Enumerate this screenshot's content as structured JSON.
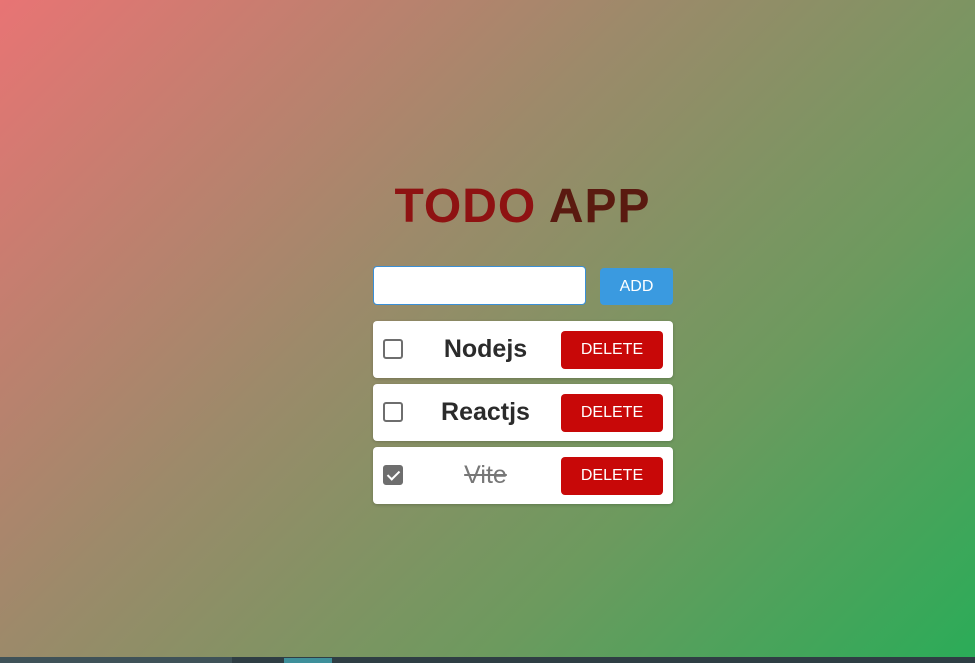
{
  "app": {
    "title_part1": "TODO",
    "title_part2": "APP"
  },
  "add_form": {
    "input_value": "",
    "input_placeholder": "",
    "add_label": "ADD"
  },
  "todos": [
    {
      "text": "Nodejs",
      "completed": false,
      "delete_label": "DELETE"
    },
    {
      "text": "Reactjs",
      "completed": false,
      "delete_label": "DELETE"
    },
    {
      "text": "Vite",
      "completed": true,
      "delete_label": "DELETE"
    }
  ],
  "colors": {
    "title_primary": "#8e1212",
    "title_secondary": "#5a1a10",
    "add_button": "#3a9ae0",
    "delete_button": "#c80808",
    "gradient_start": "#e87474",
    "gradient_end": "#2aac58"
  }
}
